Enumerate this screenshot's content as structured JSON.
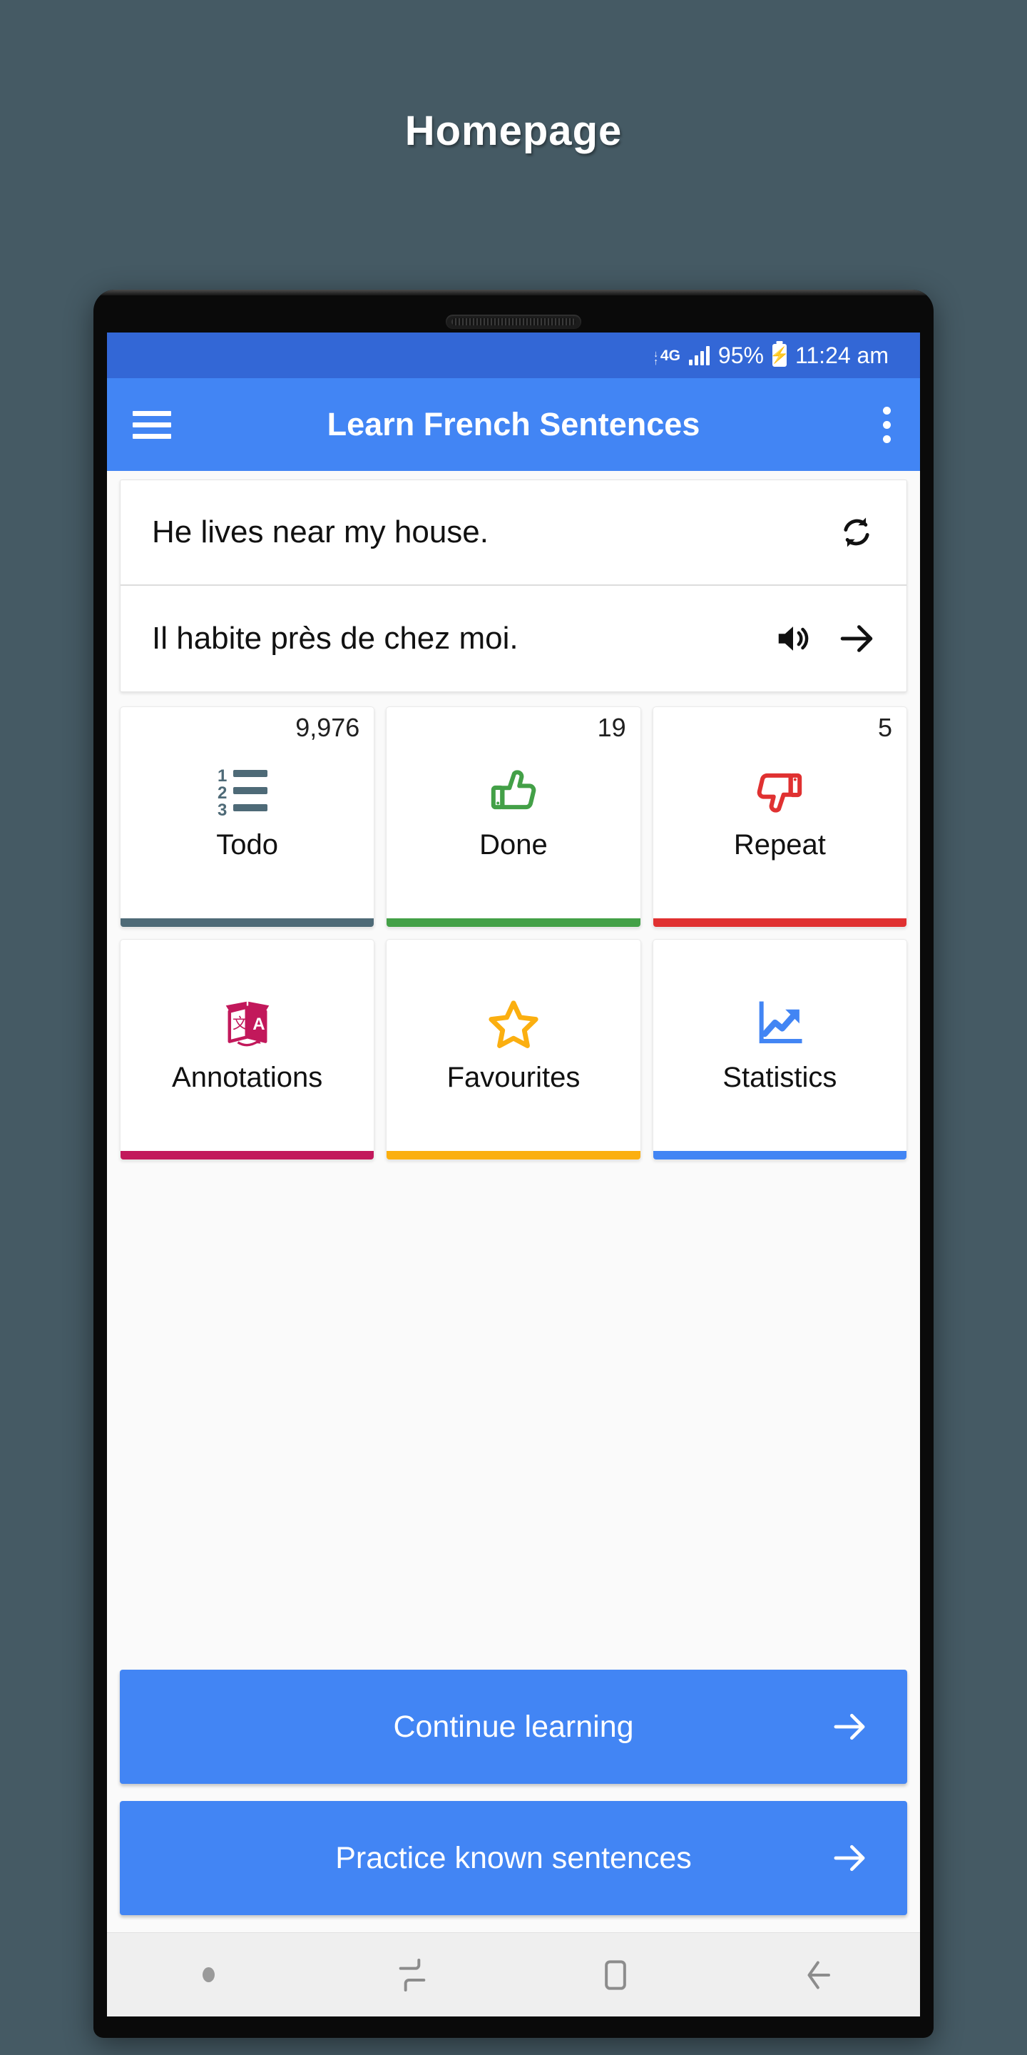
{
  "page": {
    "title": "Homepage",
    "background_color": "#455A64"
  },
  "phone": {
    "status_bar": {
      "network_type": "4G",
      "network_arrows_icon": "data-transfer-arrows-icon",
      "signal_icon": "signal-bars-icon",
      "battery_percent": "95%",
      "battery_icon": "battery-charging-icon",
      "time": "11:24 am",
      "background_color": "#3367D6"
    },
    "app_bar": {
      "menu_icon": "hamburger-menu-icon",
      "title": "Learn French Sentences",
      "overflow_icon": "more-vertical-icon",
      "background_color": "#4285F4"
    },
    "sentence_card": {
      "source_sentence": "He lives near my house.",
      "source_action_icon": "refresh-sync-icon",
      "target_sentence": "Il habite près de chez moi.",
      "speaker_icon": "volume-speaker-icon",
      "next_icon": "arrow-right-icon"
    },
    "tiles": [
      {
        "label": "Todo",
        "count": "9,976",
        "icon": "numbered-list-icon",
        "color": "#4E6A77"
      },
      {
        "label": "Done",
        "count": "19",
        "icon": "thumbs-up-icon",
        "color": "#43A047"
      },
      {
        "label": "Repeat",
        "count": "5",
        "icon": "thumbs-down-icon",
        "color": "#E03131"
      },
      {
        "label": "Annotations",
        "count": "",
        "icon": "translate-icon",
        "color": "#C2185B"
      },
      {
        "label": "Favourites",
        "count": "",
        "icon": "star-outline-icon",
        "color": "#FBAF10"
      },
      {
        "label": "Statistics",
        "count": "",
        "icon": "line-chart-up-icon",
        "color": "#4285F4"
      }
    ],
    "actions": [
      {
        "label": "Continue learning",
        "icon": "arrow-right-icon"
      },
      {
        "label": "Practice known sentences",
        "icon": "arrow-right-icon"
      }
    ],
    "nav_bar": {
      "dot_icon": "nav-dot-icon",
      "recents_icon": "recent-apps-icon",
      "home_icon": "home-square-icon",
      "back_icon": "back-arrow-icon"
    }
  }
}
